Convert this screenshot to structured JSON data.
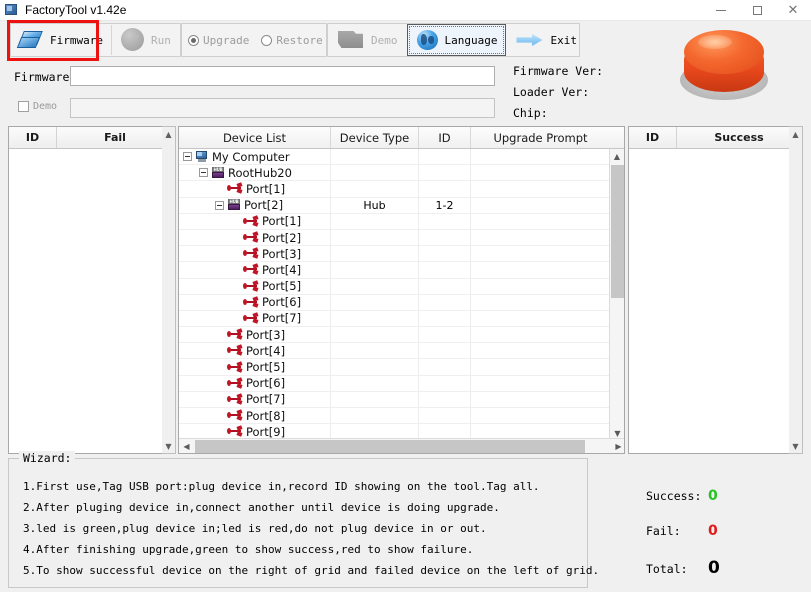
{
  "window": {
    "title": "FactoryTool v1.42e",
    "icon": "app-icon",
    "controls": {
      "minimize": "–",
      "maximize": "□",
      "close": "✕"
    }
  },
  "toolbar": {
    "firmware_label": "Firmware",
    "run_label": "Run",
    "upgrade_label": "Upgrade",
    "restore_label": "Restore",
    "demo_label": "Demo",
    "language_label": "Language",
    "exit_label": "Exit",
    "upgrade_selected": true,
    "restore_selected": false,
    "highlight_color": "#ee1111"
  },
  "firmware_panel": {
    "firmware_label": "Firmware",
    "firmware_value": "",
    "demo_checkbox_label": "Demo",
    "demo_checked": false,
    "demo_value": "",
    "firmware_ver_label": "Firmware Ver:",
    "loader_ver_label": "Loader Ver:",
    "chip_label": "Chip:",
    "firmware_ver_value": "",
    "loader_ver_value": "",
    "chip_value": "",
    "led_color": "#e8491d"
  },
  "fail_grid": {
    "columns": [
      "ID",
      "Fail"
    ],
    "rows": []
  },
  "success_grid": {
    "columns": [
      "ID",
      "Success"
    ],
    "rows": []
  },
  "device_tree": {
    "columns": [
      "Device List",
      "Device Type",
      "ID",
      "Upgrade Prompt"
    ],
    "rows": [
      {
        "label": "My Computer",
        "depth": 0,
        "icon": "computer-icon",
        "expander": "minus",
        "type": "",
        "id": "",
        "prompt": ""
      },
      {
        "label": "RootHub20",
        "depth": 1,
        "icon": "hub-icon",
        "expander": "minus",
        "type": "",
        "id": "",
        "prompt": ""
      },
      {
        "label": "Port[1]",
        "depth": 2,
        "icon": "usb-icon",
        "expander": "none",
        "type": "",
        "id": "",
        "prompt": ""
      },
      {
        "label": "Port[2]",
        "depth": 2,
        "icon": "hub-icon",
        "expander": "minus",
        "type": "Hub",
        "id": "1-2",
        "prompt": ""
      },
      {
        "label": "Port[1]",
        "depth": 3,
        "icon": "usb-icon",
        "expander": "none",
        "type": "",
        "id": "",
        "prompt": ""
      },
      {
        "label": "Port[2]",
        "depth": 3,
        "icon": "usb-icon",
        "expander": "none",
        "type": "",
        "id": "",
        "prompt": ""
      },
      {
        "label": "Port[3]",
        "depth": 3,
        "icon": "usb-icon",
        "expander": "none",
        "type": "",
        "id": "",
        "prompt": ""
      },
      {
        "label": "Port[4]",
        "depth": 3,
        "icon": "usb-icon",
        "expander": "none",
        "type": "",
        "id": "",
        "prompt": ""
      },
      {
        "label": "Port[5]",
        "depth": 3,
        "icon": "usb-icon",
        "expander": "none",
        "type": "",
        "id": "",
        "prompt": ""
      },
      {
        "label": "Port[6]",
        "depth": 3,
        "icon": "usb-icon",
        "expander": "none",
        "type": "",
        "id": "",
        "prompt": ""
      },
      {
        "label": "Port[7]",
        "depth": 3,
        "icon": "usb-icon",
        "expander": "none",
        "type": "",
        "id": "",
        "prompt": ""
      },
      {
        "label": "Port[3]",
        "depth": 2,
        "icon": "usb-icon",
        "expander": "none",
        "type": "",
        "id": "",
        "prompt": ""
      },
      {
        "label": "Port[4]",
        "depth": 2,
        "icon": "usb-icon",
        "expander": "none",
        "type": "",
        "id": "",
        "prompt": ""
      },
      {
        "label": "Port[5]",
        "depth": 2,
        "icon": "usb-icon",
        "expander": "none",
        "type": "",
        "id": "",
        "prompt": ""
      },
      {
        "label": "Port[6]",
        "depth": 2,
        "icon": "usb-icon",
        "expander": "none",
        "type": "",
        "id": "",
        "prompt": ""
      },
      {
        "label": "Port[7]",
        "depth": 2,
        "icon": "usb-icon",
        "expander": "none",
        "type": "",
        "id": "",
        "prompt": ""
      },
      {
        "label": "Port[8]",
        "depth": 2,
        "icon": "usb-icon",
        "expander": "none",
        "type": "",
        "id": "",
        "prompt": ""
      },
      {
        "label": "Port[9]",
        "depth": 2,
        "icon": "usb-icon",
        "expander": "none",
        "type": "",
        "id": "",
        "prompt": ""
      }
    ]
  },
  "wizard": {
    "title": "Wizard:",
    "lines": [
      "1.First use,Tag USB port:plug device in,record ID showing on the tool.Tag all.",
      "2.After pluging device in,connect another until device is doing upgrade.",
      "3.led is green,plug device in;led is red,do not plug device in or out.",
      "4.After finishing upgrade,green to show success,red to show failure.",
      "5.To show successful device on the right of grid and failed device on the left of grid."
    ]
  },
  "stats": {
    "success_label": "Success:",
    "success_value": "0",
    "success_color": "#22c322",
    "fail_label": "Fail:",
    "fail_value": "0",
    "fail_color": "#e01b1b",
    "total_label": "Total:",
    "total_value": "0",
    "total_color": "#000000"
  }
}
